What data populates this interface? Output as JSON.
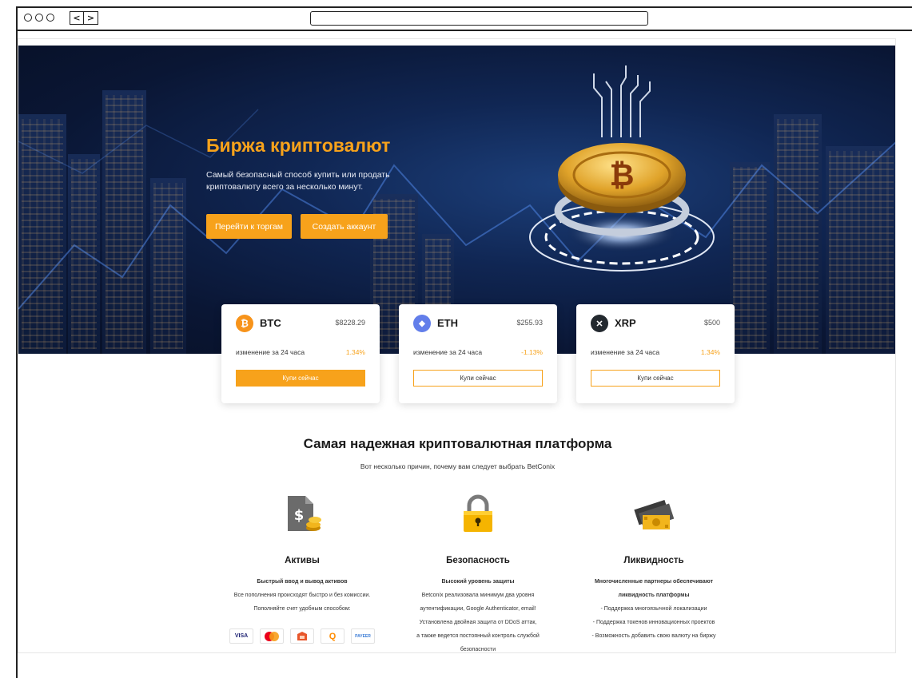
{
  "browser": {
    "back_glyph": "<",
    "forward_glyph": ">"
  },
  "hero": {
    "title": "Биржа криптовалют",
    "subtitle": "Самый безопасный способ купить или продать криптовалюту всего за несколько минут.",
    "btn_trade": "Перейти к торгам",
    "btn_create": "Создать аккаунт",
    "accent_color": "#f7a21b"
  },
  "tickers": [
    {
      "symbol": "BTC",
      "icon": "bitcoin-icon",
      "glyph": "₿",
      "color": "#f7931a",
      "price": "$8228.29",
      "change_label": "изменение за 24 часа",
      "change": "1.34%",
      "buy_label": "Купи сейчас"
    },
    {
      "symbol": "ETH",
      "icon": "ethereum-icon",
      "glyph": "◆",
      "color": "#627eea",
      "price": "$255.93",
      "change_label": "изменение за 24 часа",
      "change": "-1.13%",
      "buy_label": "Купи сейчас"
    },
    {
      "symbol": "XRP",
      "icon": "xrp-icon",
      "glyph": "✕",
      "color": "#23292f",
      "price": "$500",
      "change_label": "изменение за 24 часа",
      "change": "1.34%",
      "buy_label": "Купи сейчас"
    }
  ],
  "features_section": {
    "title": "Самая надежная криптовалютная платформа",
    "subtitle": "Вот несколько причин, почему вам следует выбрать BetConix",
    "items": [
      {
        "title": "Активы",
        "icon": "dollar-document-icon",
        "lines": [
          "Быстрый ввод и вывод активов",
          "Все пополнения происходят быстро и без комиссии.",
          "Пополняйте счет удобным способом:"
        ]
      },
      {
        "title": "Безопасность",
        "icon": "padlock-icon",
        "lines": [
          "Высокий уровень защиты",
          "Betconix реализовала минимум два уровня",
          "аутентификации, Google Authenticator, email!",
          "Установлена двойная защита от DDoS аттак,",
          "а также ведется постоянный контроль службой",
          "безопасности"
        ]
      },
      {
        "title": "Ликвидность",
        "icon": "cash-icon",
        "lines": [
          "Многочисленные партнеры обеспечивают",
          "ликвидность платформы",
          "- Поддержка многоязычной локализации",
          "- Поддержка токенов инновационных проектов",
          "- Возможность добавить свою валюту на биржу"
        ]
      }
    ],
    "payment_methods": [
      {
        "name": "visa",
        "label": "VISA"
      },
      {
        "name": "mastercard",
        "label": ""
      },
      {
        "name": "webmoney",
        "label": ""
      },
      {
        "name": "qiwi",
        "label": "Q"
      },
      {
        "name": "payeer",
        "label": "PAYEER"
      }
    ]
  }
}
